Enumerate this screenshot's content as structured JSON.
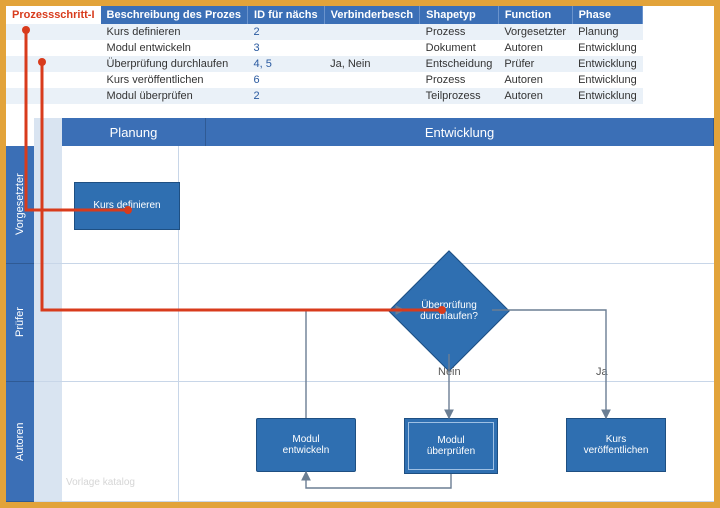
{
  "table": {
    "headers": [
      "Prozessschritt-I",
      "Beschreibung des Prozes",
      "ID für nächs",
      "Verbinderbesch",
      "Shapetyp",
      "Function",
      "Phase"
    ],
    "rows": [
      {
        "desc": "Kurs definieren",
        "next": "2",
        "conn": "",
        "shape": "Prozess",
        "func": "Vorgesetzter",
        "phase": "Planung"
      },
      {
        "desc": "Modul entwickeln",
        "next": "3",
        "conn": "",
        "shape": "Dokument",
        "func": "Autoren",
        "phase": "Entwicklung"
      },
      {
        "desc": "Überprüfung durchlaufen",
        "next": "4, 5",
        "conn": "Ja, Nein",
        "shape": "Entscheidung",
        "func": "Prüfer",
        "phase": "Entwicklung"
      },
      {
        "desc": "Kurs veröffentlichen",
        "next": "6",
        "conn": "",
        "shape": "Prozess",
        "func": "Autoren",
        "phase": "Entwicklung"
      },
      {
        "desc": "Modul überprüfen",
        "next": "2",
        "conn": "",
        "shape": "Teilprozess",
        "func": "Autoren",
        "phase": "Entwicklung"
      }
    ]
  },
  "phases": {
    "planning": "Planung",
    "development": "Entwicklung"
  },
  "lanes": {
    "supervisor": "Vorgesetzter",
    "reviewer": "Prüfer",
    "authors": "Autoren"
  },
  "nodes": {
    "define": "Kurs definieren",
    "develop": "Modul\nentwickeln",
    "review": "Überprüfung\ndurchlaufen?",
    "check": "Modul\nüberprüfen",
    "publish": "Kurs\nveröffentlichen"
  },
  "edges": {
    "no": "Nein",
    "yes": "Ja"
  },
  "watermark": "Vorlage katalog",
  "chart_data": {
    "type": "diagram",
    "subtype": "swimlane-flowchart",
    "phases": [
      "Planung",
      "Entwicklung"
    ],
    "lanes": [
      "Vorgesetzter",
      "Prüfer",
      "Autoren"
    ],
    "nodes": [
      {
        "id": 1,
        "label": "Kurs definieren",
        "shape": "process",
        "lane": "Vorgesetzter",
        "phase": "Planung"
      },
      {
        "id": 2,
        "label": "Modul entwickeln",
        "shape": "document",
        "lane": "Autoren",
        "phase": "Entwicklung"
      },
      {
        "id": 3,
        "label": "Überprüfung durchlaufen",
        "shape": "decision",
        "lane": "Prüfer",
        "phase": "Entwicklung"
      },
      {
        "id": 4,
        "label": "Kurs veröffentlichen",
        "shape": "process",
        "lane": "Autoren",
        "phase": "Entwicklung"
      },
      {
        "id": 5,
        "label": "Modul überprüfen",
        "shape": "subprocess",
        "lane": "Autoren",
        "phase": "Entwicklung"
      }
    ],
    "edges": [
      {
        "from": 1,
        "to": 2,
        "label": ""
      },
      {
        "from": 2,
        "to": 3,
        "label": ""
      },
      {
        "from": 3,
        "to": 4,
        "label": "Ja"
      },
      {
        "from": 3,
        "to": 5,
        "label": "Nein"
      },
      {
        "from": 5,
        "to": 2,
        "label": ""
      }
    ]
  }
}
